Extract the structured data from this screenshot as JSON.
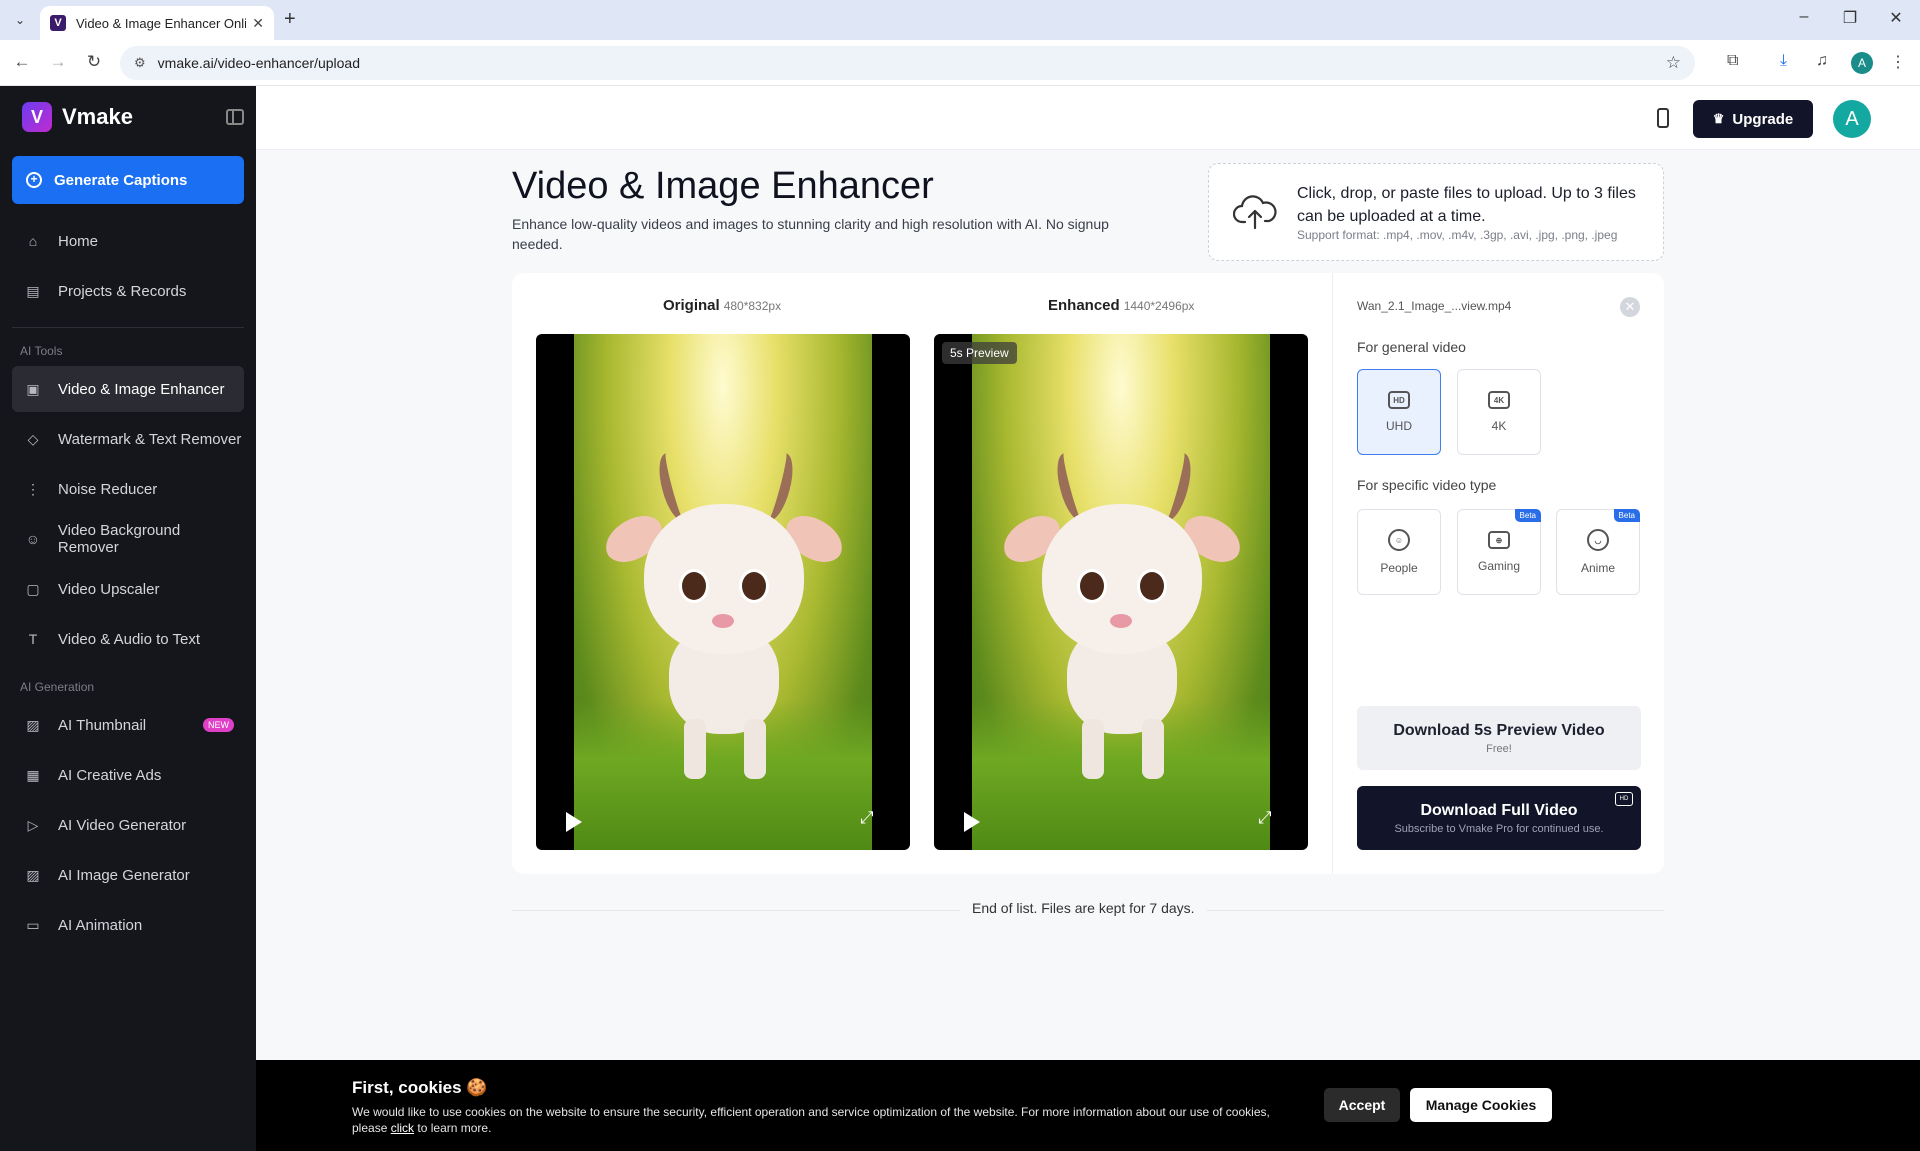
{
  "browser": {
    "tab_title": "Video & Image Enhancer Online",
    "url": "vmake.ai/video-enhancer/upload",
    "profile_initial": "A"
  },
  "sidebar": {
    "brand": "Vmake",
    "generate_label": "Generate Captions",
    "main_items": [
      {
        "label": "Home",
        "icon": "home-icon"
      },
      {
        "label": "Projects & Records",
        "icon": "projects-icon"
      }
    ],
    "ai_tools_label": "AI Tools",
    "ai_tools": [
      {
        "label": "Video & Image Enhancer",
        "icon": "hd-icon",
        "active": true
      },
      {
        "label": "Watermark & Text Remover",
        "icon": "eraser-icon"
      },
      {
        "label": "Noise Reducer",
        "icon": "noise-icon"
      },
      {
        "label": "Video Background Remover",
        "icon": "person-icon"
      },
      {
        "label": "Video Upscaler",
        "icon": "4k-icon"
      },
      {
        "label": "Video & Audio to Text",
        "icon": "text-icon"
      }
    ],
    "ai_generation_label": "AI Generation",
    "ai_generation": [
      {
        "label": "AI Thumbnail",
        "icon": "image-icon",
        "badge": "NEW"
      },
      {
        "label": "AI Creative Ads",
        "icon": "ad-icon"
      },
      {
        "label": "AI Video Generator",
        "icon": "play-icon"
      },
      {
        "label": "AI Image Generator",
        "icon": "image-icon"
      },
      {
        "label": "AI Animation",
        "icon": "clapper-icon"
      }
    ]
  },
  "header": {
    "upgrade_label": "Upgrade",
    "avatar_initial": "A"
  },
  "main": {
    "title": "Video & Image Enhancer",
    "subtitle": "Enhance low-quality videos and images to stunning clarity and high resolution with AI. No signup needed.",
    "upload": {
      "title": "Click, drop, or paste files to upload. Up to 3 files can be uploaded at a time.",
      "formats": "Support format: .mp4, .mov, .m4v, .3gp, .avi, .jpg, .png, .jpeg"
    },
    "original_label": "Original",
    "original_dim": "480*832px",
    "enhanced_label": "Enhanced",
    "enhanced_dim": "1440*2496px",
    "preview_badge": "5s Preview",
    "file_name": "Wan_2.1_Image_...view.mp4",
    "general_label": "For general video",
    "general_options": [
      {
        "label": "UHD",
        "icon_text": "HD",
        "selected": true
      },
      {
        "label": "4K",
        "icon_text": "4K",
        "selected": false
      }
    ],
    "specific_label": "For specific video type",
    "specific_options": [
      {
        "label": "People",
        "beta": ""
      },
      {
        "label": "Gaming",
        "beta": "Beta"
      },
      {
        "label": "Anime",
        "beta": "Beta"
      }
    ],
    "download_preview": {
      "title": "Download 5s Preview Video",
      "sub": "Free!"
    },
    "download_full": {
      "title": "Download Full Video",
      "sub": "Subscribe to Vmake Pro for continued use."
    },
    "end_text": "End of list. Files are kept for 7 days."
  },
  "cookies": {
    "title": "First, cookies 🍪",
    "text_before": "We would like to use cookies on the website to ensure the security, efficient operation and service optimization of the website. For more information about our use of cookies, please ",
    "link": "click",
    "text_after": " to learn more.",
    "accept": "Accept",
    "manage": "Manage Cookies"
  }
}
